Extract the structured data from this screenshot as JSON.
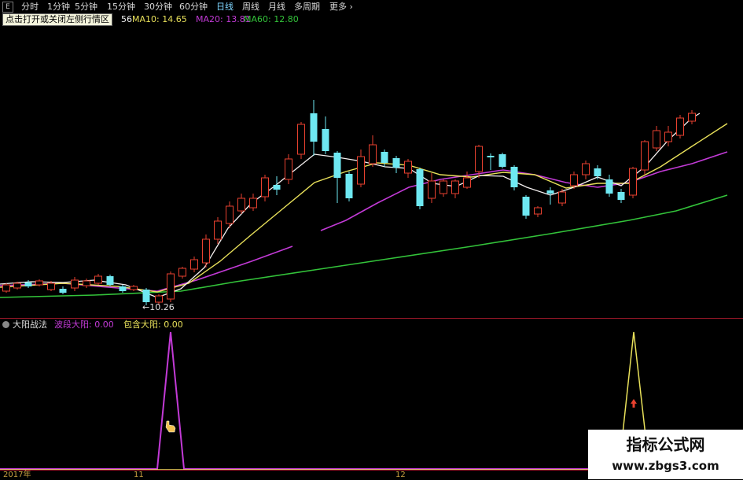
{
  "toolbar": {
    "e_label": "E",
    "items": [
      {
        "label": "分时"
      },
      {
        "label": "1分钟"
      },
      {
        "label": "5分钟"
      },
      {
        "label": "15分钟"
      },
      {
        "label": "30分钟"
      },
      {
        "label": "60分钟"
      },
      {
        "label": "日线"
      },
      {
        "label": "周线"
      },
      {
        "label": "月线"
      },
      {
        "label": "多周期"
      },
      {
        "label": "更多 ›"
      }
    ],
    "active_index": 6
  },
  "tooltip": "点击打开或关闭左侧行情区",
  "ma_labels": {
    "hidden_tail": "56",
    "ma10": "MA10: 14.65",
    "ma20": "MA20: 13.81",
    "ma60": "MA60: 12.80"
  },
  "colors": {
    "up": "#e8412f",
    "down": "#6ee8f2",
    "ma5": "#f5f0f0",
    "ma10": "#e8e05a",
    "ma20": "#c23ad6",
    "ma60": "#33c33a",
    "ind_purple": "#c23ad6",
    "ind_yellow": "#e8e05a",
    "divider": "#a0182a"
  },
  "main_chart": {
    "low_annotation": "←10.26"
  },
  "indicator": {
    "name": "大阳战法",
    "line1": "波段大阳: 0.00",
    "line2": "包含大阳: 0.00"
  },
  "xaxis": {
    "labels": [
      "2017年",
      "11",
      "12"
    ]
  },
  "watermark": {
    "title": "指标公式网",
    "url": "www.zbgs3.com"
  }
}
